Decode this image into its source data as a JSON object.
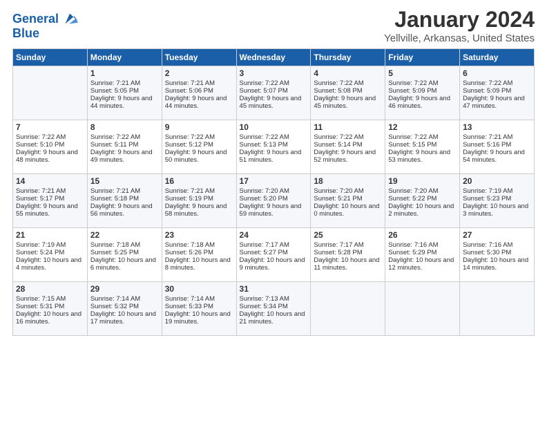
{
  "logo": {
    "line1": "General",
    "line2": "Blue"
  },
  "title": "January 2024",
  "location": "Yellville, Arkansas, United States",
  "weekdays": [
    "Sunday",
    "Monday",
    "Tuesday",
    "Wednesday",
    "Thursday",
    "Friday",
    "Saturday"
  ],
  "weeks": [
    [
      {
        "day": "",
        "sunrise": "",
        "sunset": "",
        "daylight": ""
      },
      {
        "day": "1",
        "sunrise": "Sunrise: 7:21 AM",
        "sunset": "Sunset: 5:05 PM",
        "daylight": "Daylight: 9 hours and 44 minutes."
      },
      {
        "day": "2",
        "sunrise": "Sunrise: 7:21 AM",
        "sunset": "Sunset: 5:06 PM",
        "daylight": "Daylight: 9 hours and 44 minutes."
      },
      {
        "day": "3",
        "sunrise": "Sunrise: 7:22 AM",
        "sunset": "Sunset: 5:07 PM",
        "daylight": "Daylight: 9 hours and 45 minutes."
      },
      {
        "day": "4",
        "sunrise": "Sunrise: 7:22 AM",
        "sunset": "Sunset: 5:08 PM",
        "daylight": "Daylight: 9 hours and 45 minutes."
      },
      {
        "day": "5",
        "sunrise": "Sunrise: 7:22 AM",
        "sunset": "Sunset: 5:09 PM",
        "daylight": "Daylight: 9 hours and 46 minutes."
      },
      {
        "day": "6",
        "sunrise": "Sunrise: 7:22 AM",
        "sunset": "Sunset: 5:09 PM",
        "daylight": "Daylight: 9 hours and 47 minutes."
      }
    ],
    [
      {
        "day": "7",
        "sunrise": "Sunrise: 7:22 AM",
        "sunset": "Sunset: 5:10 PM",
        "daylight": "Daylight: 9 hours and 48 minutes."
      },
      {
        "day": "8",
        "sunrise": "Sunrise: 7:22 AM",
        "sunset": "Sunset: 5:11 PM",
        "daylight": "Daylight: 9 hours and 49 minutes."
      },
      {
        "day": "9",
        "sunrise": "Sunrise: 7:22 AM",
        "sunset": "Sunset: 5:12 PM",
        "daylight": "Daylight: 9 hours and 50 minutes."
      },
      {
        "day": "10",
        "sunrise": "Sunrise: 7:22 AM",
        "sunset": "Sunset: 5:13 PM",
        "daylight": "Daylight: 9 hours and 51 minutes."
      },
      {
        "day": "11",
        "sunrise": "Sunrise: 7:22 AM",
        "sunset": "Sunset: 5:14 PM",
        "daylight": "Daylight: 9 hours and 52 minutes."
      },
      {
        "day": "12",
        "sunrise": "Sunrise: 7:22 AM",
        "sunset": "Sunset: 5:15 PM",
        "daylight": "Daylight: 9 hours and 53 minutes."
      },
      {
        "day": "13",
        "sunrise": "Sunrise: 7:21 AM",
        "sunset": "Sunset: 5:16 PM",
        "daylight": "Daylight: 9 hours and 54 minutes."
      }
    ],
    [
      {
        "day": "14",
        "sunrise": "Sunrise: 7:21 AM",
        "sunset": "Sunset: 5:17 PM",
        "daylight": "Daylight: 9 hours and 55 minutes."
      },
      {
        "day": "15",
        "sunrise": "Sunrise: 7:21 AM",
        "sunset": "Sunset: 5:18 PM",
        "daylight": "Daylight: 9 hours and 56 minutes."
      },
      {
        "day": "16",
        "sunrise": "Sunrise: 7:21 AM",
        "sunset": "Sunset: 5:19 PM",
        "daylight": "Daylight: 9 hours and 58 minutes."
      },
      {
        "day": "17",
        "sunrise": "Sunrise: 7:20 AM",
        "sunset": "Sunset: 5:20 PM",
        "daylight": "Daylight: 9 hours and 59 minutes."
      },
      {
        "day": "18",
        "sunrise": "Sunrise: 7:20 AM",
        "sunset": "Sunset: 5:21 PM",
        "daylight": "Daylight: 10 hours and 0 minutes."
      },
      {
        "day": "19",
        "sunrise": "Sunrise: 7:20 AM",
        "sunset": "Sunset: 5:22 PM",
        "daylight": "Daylight: 10 hours and 2 minutes."
      },
      {
        "day": "20",
        "sunrise": "Sunrise: 7:19 AM",
        "sunset": "Sunset: 5:23 PM",
        "daylight": "Daylight: 10 hours and 3 minutes."
      }
    ],
    [
      {
        "day": "21",
        "sunrise": "Sunrise: 7:19 AM",
        "sunset": "Sunset: 5:24 PM",
        "daylight": "Daylight: 10 hours and 4 minutes."
      },
      {
        "day": "22",
        "sunrise": "Sunrise: 7:18 AM",
        "sunset": "Sunset: 5:25 PM",
        "daylight": "Daylight: 10 hours and 6 minutes."
      },
      {
        "day": "23",
        "sunrise": "Sunrise: 7:18 AM",
        "sunset": "Sunset: 5:26 PM",
        "daylight": "Daylight: 10 hours and 8 minutes."
      },
      {
        "day": "24",
        "sunrise": "Sunrise: 7:17 AM",
        "sunset": "Sunset: 5:27 PM",
        "daylight": "Daylight: 10 hours and 9 minutes."
      },
      {
        "day": "25",
        "sunrise": "Sunrise: 7:17 AM",
        "sunset": "Sunset: 5:28 PM",
        "daylight": "Daylight: 10 hours and 11 minutes."
      },
      {
        "day": "26",
        "sunrise": "Sunrise: 7:16 AM",
        "sunset": "Sunset: 5:29 PM",
        "daylight": "Daylight: 10 hours and 12 minutes."
      },
      {
        "day": "27",
        "sunrise": "Sunrise: 7:16 AM",
        "sunset": "Sunset: 5:30 PM",
        "daylight": "Daylight: 10 hours and 14 minutes."
      }
    ],
    [
      {
        "day": "28",
        "sunrise": "Sunrise: 7:15 AM",
        "sunset": "Sunset: 5:31 PM",
        "daylight": "Daylight: 10 hours and 16 minutes."
      },
      {
        "day": "29",
        "sunrise": "Sunrise: 7:14 AM",
        "sunset": "Sunset: 5:32 PM",
        "daylight": "Daylight: 10 hours and 17 minutes."
      },
      {
        "day": "30",
        "sunrise": "Sunrise: 7:14 AM",
        "sunset": "Sunset: 5:33 PM",
        "daylight": "Daylight: 10 hours and 19 minutes."
      },
      {
        "day": "31",
        "sunrise": "Sunrise: 7:13 AM",
        "sunset": "Sunset: 5:34 PM",
        "daylight": "Daylight: 10 hours and 21 minutes."
      },
      {
        "day": "",
        "sunrise": "",
        "sunset": "",
        "daylight": ""
      },
      {
        "day": "",
        "sunrise": "",
        "sunset": "",
        "daylight": ""
      },
      {
        "day": "",
        "sunrise": "",
        "sunset": "",
        "daylight": ""
      }
    ]
  ]
}
